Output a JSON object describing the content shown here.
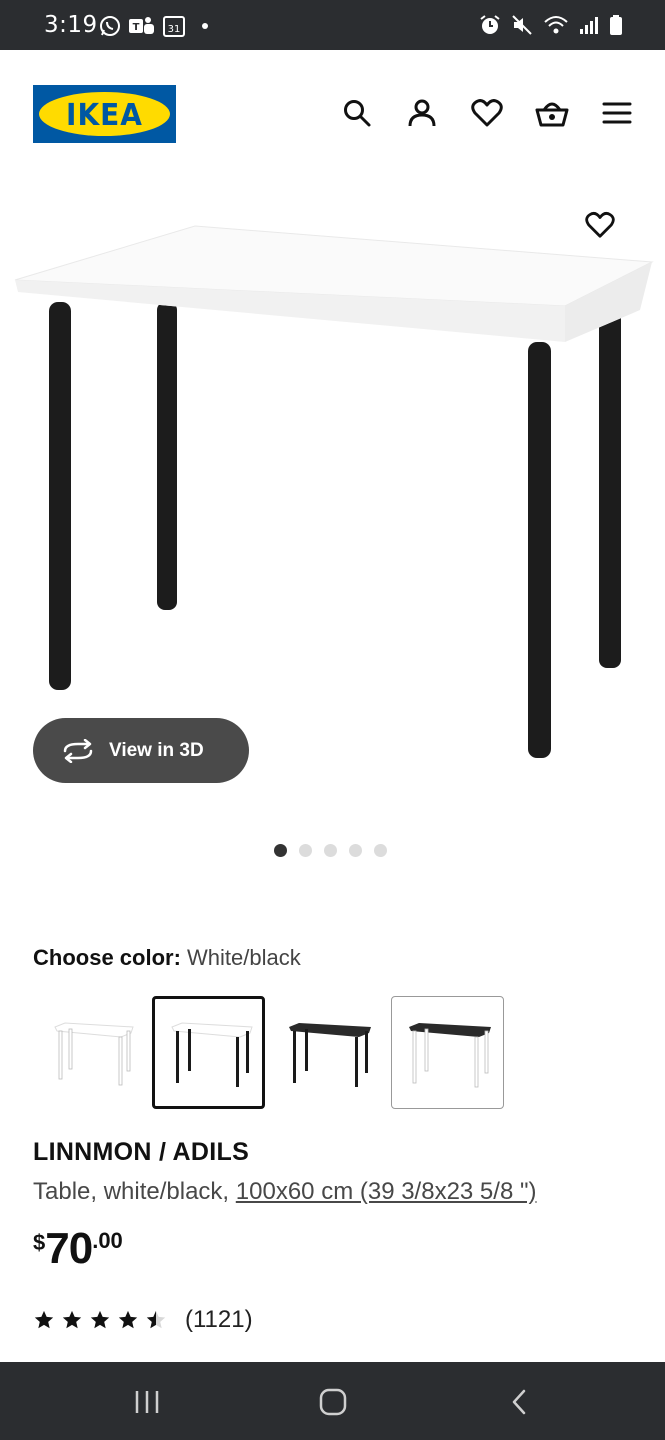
{
  "status_bar": {
    "time": "3:19",
    "left_icons": [
      "whatsapp-icon",
      "teams-icon",
      "calendar-icon"
    ],
    "calendar_day": "31",
    "right_icons": [
      "alarm-icon",
      "mute-icon",
      "wifi-icon",
      "signal-icon",
      "battery-icon"
    ]
  },
  "header": {
    "logo_text": "IKEA",
    "icons": [
      "search-icon",
      "account-icon",
      "wishlist-icon",
      "basket-icon",
      "menu-icon"
    ]
  },
  "gallery": {
    "view3d_label": "View in 3D",
    "page_count": 5,
    "active_page": 1
  },
  "color_chooser": {
    "label": "Choose color:",
    "selected_value": "White/black",
    "swatches": [
      {
        "name": "White",
        "top": "#ffffff",
        "legs": "#ffffff"
      },
      {
        "name": "White/black",
        "top": "#ffffff",
        "legs": "#1a1a1a",
        "selected": true
      },
      {
        "name": "Black-brown",
        "top": "#2a2a2a",
        "legs": "#1a1a1a"
      },
      {
        "name": "Black-brown/white",
        "top": "#2a2a2a",
        "legs": "#ffffff"
      }
    ]
  },
  "product": {
    "name": "LINNMON / ADILS",
    "description_prefix": "Table, white/black, ",
    "dimensions": "100x60 cm (39 3/8x23 5/8 \")",
    "price_currency": "$",
    "price_integer": "70",
    "price_decimal": ".00",
    "rating_value": 4.5,
    "rating_count": "(1121)"
  },
  "colors": {
    "status_bg": "#2b2d30",
    "ikea_blue": "#0058a3",
    "ikea_yellow": "#ffdb00",
    "view3d_bg": "#4a4a4a"
  }
}
